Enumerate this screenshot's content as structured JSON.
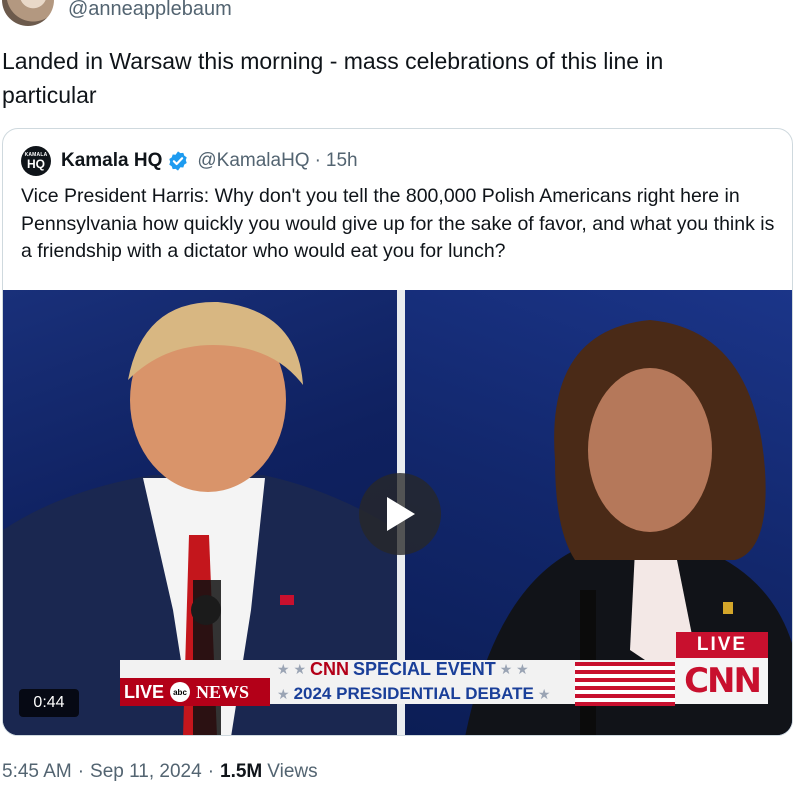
{
  "author": {
    "handle": "@anneapplebaum"
  },
  "tweet": {
    "text": "Landed in Warsaw this morning - mass celebrations of this line in particular"
  },
  "quote": {
    "logo_line1": "KAMALA",
    "logo_line2": "HQ",
    "name": "Kamala HQ",
    "handle": "@KamalaHQ",
    "separator": "·",
    "age": "15h",
    "text": "Vice President Harris: Why don't you tell the 800,000 Polish Americans right here in Pennsylvania how quickly you would give up for the sake of favor, and what you think is a friendship with a dictator who would eat you for lunch?"
  },
  "video": {
    "duration": "0:44",
    "chyron": {
      "live": "LIVE",
      "network_abc": "abc",
      "network_news": "NEWS",
      "cnn_small": "CNN",
      "event": "SPECIAL EVENT",
      "subtitle": "2024 PRESIDENTIAL DEBATE",
      "live_tag": "LIVE",
      "cnn_logo": "CNN"
    }
  },
  "footer": {
    "time": "5:45 AM",
    "date": "Sep 11, 2024",
    "views_count": "1.5M",
    "views_label": "Views",
    "separator": "·"
  },
  "colors": {
    "verified": "#1d9bf0",
    "cnn_red": "#c8102e",
    "muted": "#536471"
  }
}
